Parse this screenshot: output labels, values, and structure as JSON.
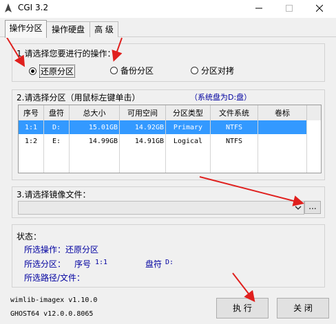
{
  "window": {
    "title": "CGI 3.2"
  },
  "tabs": [
    {
      "label": "操作分区"
    },
    {
      "label": "操作硬盘"
    },
    {
      "label": "高 级"
    }
  ],
  "operation": {
    "heading": "1.请选择您要进行的操作：",
    "options": [
      {
        "label": "还原分区",
        "selected": true
      },
      {
        "label": "备份分区",
        "selected": false
      },
      {
        "label": "分区对拷",
        "selected": false
      }
    ]
  },
  "partition": {
    "heading": "2.请选择分区（用鼠标左键单击）",
    "system_note": "（系统盘为D:盘）",
    "columns": [
      "序号",
      "盘符",
      "总大小",
      "可用空间",
      "分区类型",
      "文件系统",
      "卷标"
    ],
    "rows": [
      {
        "no": "1:1",
        "drive": "D:",
        "total": "15.01GB",
        "free": "14.92GB",
        "type": "Primary",
        "fs": "NTFS",
        "label": "",
        "selected": true
      },
      {
        "no": "1:2",
        "drive": "E:",
        "total": "14.99GB",
        "free": "14.91GB",
        "type": "Logical",
        "fs": "NTFS",
        "label": "",
        "selected": false
      }
    ]
  },
  "image": {
    "heading": "3.请选择镜像文件：",
    "value": "",
    "browse_label": "..."
  },
  "status": {
    "heading": "状态：",
    "operation_label": "所选操作：",
    "operation_value": "还原分区",
    "partition_label": "所选分区：",
    "partition_no_label": "序号",
    "partition_no_value": "1:1",
    "drive_label": "盘符",
    "drive_value": "D:",
    "path_label": "所选路径/文件："
  },
  "footer": {
    "version_line1": "wimlib-imagex v1.10.0",
    "version_line2": "GHOST64 v12.0.0.8065"
  },
  "buttons": {
    "execute": "执 行",
    "close": "关 闭"
  },
  "colors": {
    "selection": "#3399ff",
    "status_text": "#0000a0",
    "annotation_arrow": "#e0201e"
  }
}
